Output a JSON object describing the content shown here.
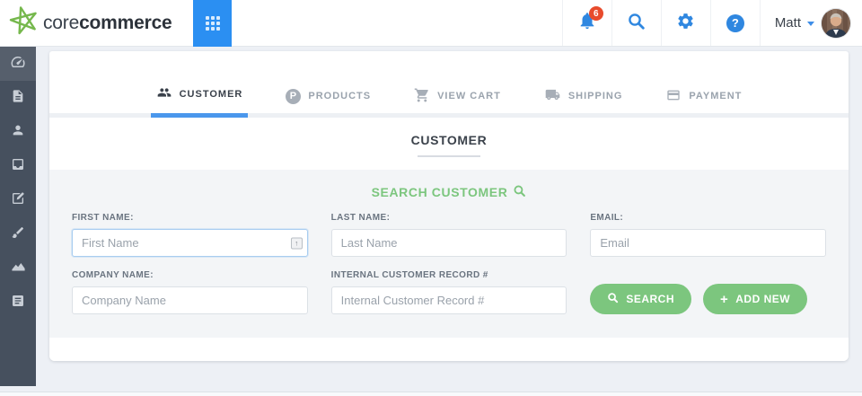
{
  "header": {
    "logo": {
      "brand_light": "core",
      "brand_bold": "commerce",
      "logo_icon": "star-logo-icon"
    },
    "apps_button_icon": "app-grid-icon",
    "notifications": {
      "icon": "bell-icon",
      "badge": "6"
    },
    "search_icon": "search-icon",
    "settings_icon": "gear-icon",
    "help": {
      "icon": "question-icon",
      "glyph": "?"
    },
    "user": {
      "name": "Matt",
      "avatar_icon": "user-avatar"
    }
  },
  "sidebar": {
    "items": [
      {
        "icon": "dashboard-icon",
        "active": true
      },
      {
        "icon": "orders-document-icon"
      },
      {
        "icon": "customers-person-icon"
      },
      {
        "icon": "inbox-icon"
      },
      {
        "icon": "edit-document-icon"
      },
      {
        "icon": "design-brush-icon"
      },
      {
        "icon": "reports-chart-icon"
      },
      {
        "icon": "pages-file-icon"
      }
    ]
  },
  "tabs": [
    {
      "label": "CUSTOMER",
      "icon": "people-icon",
      "active": true
    },
    {
      "label": "PRODUCTS",
      "icon": "p-circle-icon",
      "p_glyph": "P",
      "active": false
    },
    {
      "label": "VIEW CART",
      "icon": "cart-icon",
      "active": false
    },
    {
      "label": "SHIPPING",
      "icon": "truck-icon",
      "active": false
    },
    {
      "label": "PAYMENT",
      "icon": "credit-card-icon",
      "active": false
    }
  ],
  "main": {
    "section_title": "CUSTOMER",
    "search_title": "SEARCH CUSTOMER",
    "fields": {
      "first_name": {
        "label": "FIRST NAME:",
        "placeholder": "First Name",
        "value": "",
        "focused": true
      },
      "last_name": {
        "label": "LAST NAME:",
        "placeholder": "Last Name",
        "value": ""
      },
      "email": {
        "label": "EMAIL:",
        "placeholder": "Email",
        "value": ""
      },
      "company_name": {
        "label": "COMPANY NAME:",
        "placeholder": "Company Name",
        "value": ""
      },
      "internal_record": {
        "label": "INTERNAL CUSTOMER RECORD #",
        "placeholder": "Internal Customer Record #",
        "value": ""
      }
    },
    "buttons": {
      "search": "SEARCH",
      "add_new": "ADD NEW"
    }
  },
  "colors": {
    "accent_blue": "#2b8ff2",
    "icon_blue": "#2f87e0",
    "tab_underline_blue": "#4a97ec",
    "green": "#7cc67e",
    "logo_green": "#76b84d",
    "sidebar_bg": "#46505e",
    "badge_red": "#e84b2c",
    "page_bg": "#edf0f5",
    "form_bg": "#f3f5f7"
  }
}
